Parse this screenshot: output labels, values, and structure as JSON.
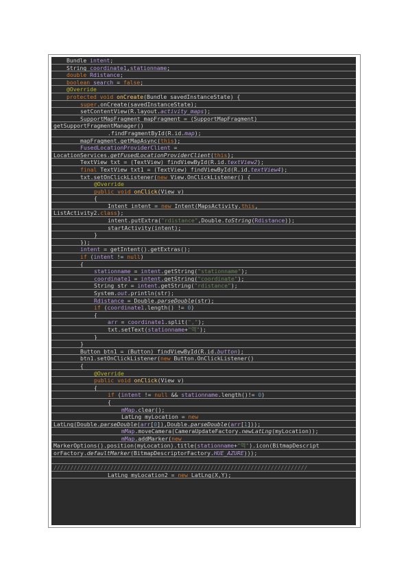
{
  "code": {
    "lines": [
      {
        "indent": 1,
        "segs": [
          {
            "t": "Bundle "
          },
          {
            "t": "intent",
            "c": "fld"
          },
          {
            "t": ";"
          }
        ]
      },
      {
        "indent": 1,
        "segs": [
          {
            "t": "String "
          },
          {
            "t": "coordinate1",
            "c": "fld"
          },
          {
            "t": ","
          },
          {
            "t": "stationname",
            "c": "fld"
          },
          {
            "t": ";"
          }
        ]
      },
      {
        "indent": 1,
        "segs": [
          {
            "t": "double ",
            "c": "kw"
          },
          {
            "t": "Rdistance",
            "c": "fld"
          },
          {
            "t": ";"
          }
        ]
      },
      {
        "indent": 1,
        "segs": [
          {
            "t": "boolean ",
            "c": "kw"
          },
          {
            "t": "search",
            "c": "fld"
          },
          {
            "t": " = "
          },
          {
            "t": "false",
            "c": "kw"
          },
          {
            "t": ";"
          }
        ]
      },
      {
        "indent": 1,
        "segs": [
          {
            "t": "@Override",
            "c": "ann"
          }
        ]
      },
      {
        "indent": 1,
        "segs": [
          {
            "t": "protected void ",
            "c": "kw"
          },
          {
            "t": "onCreate",
            "c": "mth"
          },
          {
            "t": "(Bundle savedInstanceState) {"
          }
        ]
      },
      {
        "indent": 2,
        "segs": [
          {
            "t": "super",
            "c": "kw"
          },
          {
            "t": ".onCreate(savedInstanceState);"
          }
        ]
      },
      {
        "indent": 2,
        "segs": [
          {
            "t": "setContentView(R.layout."
          },
          {
            "t": "activity_maps",
            "c": "fld ital"
          },
          {
            "t": ");"
          }
        ]
      },
      {
        "indent": 2,
        "segs": [
          {
            "t": "SupportMapFragment mapFragment = (SupportMapFragment)"
          }
        ]
      },
      {
        "indent": 0,
        "segs": [
          {
            "t": "getSupportFragmentManager()"
          }
        ]
      },
      {
        "indent": 4,
        "segs": [
          {
            "t": ".findFragmentById(R.id."
          },
          {
            "t": "map",
            "c": "fld ital"
          },
          {
            "t": ");"
          }
        ]
      },
      {
        "indent": 2,
        "segs": [
          {
            "t": "mapFragment.getMapAsync("
          },
          {
            "t": "this",
            "c": "kw"
          },
          {
            "t": ");"
          }
        ]
      },
      {
        "indent": 2,
        "segs": [
          {
            "t": "FusedLocationProviderClient",
            "c": "fld"
          },
          {
            "t": " ="
          }
        ]
      },
      {
        "indent": 0,
        "segs": [
          {
            "t": "LocationServices."
          },
          {
            "t": "getFusedLocationProviderClient",
            "c": "ital"
          },
          {
            "t": "("
          },
          {
            "t": "this",
            "c": "kw"
          },
          {
            "t": ");"
          }
        ]
      },
      {
        "indent": 2,
        "segs": [
          {
            "t": "TextView txt = (TextView) findViewById(R.id."
          },
          {
            "t": "textView2",
            "c": "fld ital"
          },
          {
            "t": ");"
          }
        ]
      },
      {
        "indent": 2,
        "segs": [
          {
            "t": "final ",
            "c": "kw"
          },
          {
            "t": "TextView txt1 = (TextView) findViewById(R.id."
          },
          {
            "t": "textView4",
            "c": "fld ital"
          },
          {
            "t": ");"
          }
        ]
      },
      {
        "indent": 2,
        "segs": [
          {
            "t": "txt.setOnClickListener("
          },
          {
            "t": "new ",
            "c": "kw"
          },
          {
            "t": "View.OnClickListener() {"
          }
        ]
      },
      {
        "indent": 3,
        "segs": [
          {
            "t": "@Override",
            "c": "ann"
          }
        ]
      },
      {
        "indent": 3,
        "segs": [
          {
            "t": "public void ",
            "c": "kw"
          },
          {
            "t": "onClick",
            "c": "mth"
          },
          {
            "t": "(View v)"
          }
        ]
      },
      {
        "indent": 3,
        "segs": [
          {
            "t": "{"
          }
        ]
      },
      {
        "indent": 4,
        "segs": [
          {
            "t": "Intent intent = "
          },
          {
            "t": "new ",
            "c": "kw"
          },
          {
            "t": "Intent(MapsActivity."
          },
          {
            "t": "this",
            "c": "kw"
          },
          {
            "t": ","
          }
        ]
      },
      {
        "indent": 0,
        "segs": [
          {
            "t": "ListActivity2."
          },
          {
            "t": "class",
            "c": "kw"
          },
          {
            "t": ");"
          }
        ]
      },
      {
        "indent": 4,
        "segs": [
          {
            "t": "intent.putExtra("
          },
          {
            "t": "\"rdistance\"",
            "c": "str"
          },
          {
            "t": ",Double."
          },
          {
            "t": "toString",
            "c": "ital"
          },
          {
            "t": "("
          },
          {
            "t": "Rdistance",
            "c": "fld"
          },
          {
            "t": "));"
          }
        ]
      },
      {
        "indent": 4,
        "segs": [
          {
            "t": "startActivity(intent);"
          }
        ]
      },
      {
        "indent": 3,
        "segs": [
          {
            "t": "}"
          }
        ]
      },
      {
        "indent": 2,
        "segs": [
          {
            "t": "});"
          }
        ]
      },
      {
        "indent": 2,
        "segs": [
          {
            "t": "intent",
            "c": "fld"
          },
          {
            "t": " = getIntent().getExtras();"
          }
        ]
      },
      {
        "indent": 2,
        "segs": [
          {
            "t": "if ",
            "c": "kw"
          },
          {
            "t": "("
          },
          {
            "t": "intent",
            "c": "fld"
          },
          {
            "t": " != "
          },
          {
            "t": "null",
            "c": "kw"
          },
          {
            "t": ")"
          }
        ]
      },
      {
        "indent": 2,
        "segs": [
          {
            "t": "{"
          }
        ]
      },
      {
        "indent": 3,
        "segs": [
          {
            "t": "stationname",
            "c": "fld"
          },
          {
            "t": " = "
          },
          {
            "t": "intent",
            "c": "fld"
          },
          {
            "t": ".getString("
          },
          {
            "t": "\"stationname\"",
            "c": "str"
          },
          {
            "t": ");"
          }
        ]
      },
      {
        "indent": 3,
        "segs": [
          {
            "t": "coordinate1",
            "c": "fld"
          },
          {
            "t": " = "
          },
          {
            "t": "intent",
            "c": "fld"
          },
          {
            "t": ".getString("
          },
          {
            "t": "\"coordinate\"",
            "c": "str"
          },
          {
            "t": ");"
          }
        ]
      },
      {
        "indent": 3,
        "segs": [
          {
            "t": "String str = "
          },
          {
            "t": "intent",
            "c": "fld"
          },
          {
            "t": ".getString("
          },
          {
            "t": "\"rdistance\"",
            "c": "str"
          },
          {
            "t": ");"
          }
        ]
      },
      {
        "indent": 3,
        "segs": [
          {
            "t": "System."
          },
          {
            "t": "out",
            "c": "fld ital"
          },
          {
            "t": ".println(str);"
          }
        ]
      },
      {
        "indent": 3,
        "segs": [
          {
            "t": "Rdistance",
            "c": "fld"
          },
          {
            "t": " = Double."
          },
          {
            "t": "parseDouble",
            "c": "ital"
          },
          {
            "t": "(str);"
          }
        ]
      },
      {
        "indent": 3,
        "segs": [
          {
            "t": "if ",
            "c": "kw"
          },
          {
            "t": "("
          },
          {
            "t": "coordinate1",
            "c": "fld"
          },
          {
            "t": ".length() != "
          },
          {
            "t": "0",
            "c": "num"
          },
          {
            "t": ")"
          }
        ]
      },
      {
        "indent": 3,
        "segs": [
          {
            "t": "{"
          }
        ]
      },
      {
        "indent": 4,
        "segs": [
          {
            "t": "arr",
            "c": "fld"
          },
          {
            "t": " = "
          },
          {
            "t": "coordinate1",
            "c": "fld"
          },
          {
            "t": ".split("
          },
          {
            "t": "\",\"",
            "c": "str"
          },
          {
            "t": ");"
          }
        ]
      },
      {
        "indent": 4,
        "segs": [
          {
            "t": "txt.setText("
          },
          {
            "t": "stationname",
            "c": "fld"
          },
          {
            "t": "+"
          },
          {
            "t": "\"역\"",
            "c": "str"
          },
          {
            "t": ");"
          }
        ]
      },
      {
        "indent": 3,
        "segs": [
          {
            "t": "}"
          }
        ]
      },
      {
        "indent": 2,
        "segs": [
          {
            "t": "}"
          }
        ]
      },
      {
        "indent": 2,
        "segs": [
          {
            "t": "Button btn1 = (Button) findViewById(R.id."
          },
          {
            "t": "button",
            "c": "fld ital"
          },
          {
            "t": ");"
          }
        ]
      },
      {
        "indent": 2,
        "segs": [
          {
            "t": "btn1.setOnClickListener("
          },
          {
            "t": "new ",
            "c": "kw"
          },
          {
            "t": "Button.OnClickListener()"
          }
        ]
      },
      {
        "indent": 2,
        "segs": [
          {
            "t": "{"
          }
        ]
      },
      {
        "indent": 3,
        "segs": [
          {
            "t": "@Override",
            "c": "ann"
          }
        ]
      },
      {
        "indent": 3,
        "segs": [
          {
            "t": "public void ",
            "c": "kw"
          },
          {
            "t": "onClick",
            "c": "mth"
          },
          {
            "t": "(View v)"
          }
        ]
      },
      {
        "indent": 3,
        "segs": [
          {
            "t": "{"
          }
        ]
      },
      {
        "indent": 4,
        "segs": [
          {
            "t": "if ",
            "c": "kw"
          },
          {
            "t": "("
          },
          {
            "t": "intent",
            "c": "fld"
          },
          {
            "t": " != "
          },
          {
            "t": "null ",
            "c": "kw"
          },
          {
            "t": "&& "
          },
          {
            "t": "stationname",
            "c": "fld"
          },
          {
            "t": ".length()!= "
          },
          {
            "t": "0",
            "c": "num"
          },
          {
            "t": ")"
          }
        ]
      },
      {
        "indent": 4,
        "segs": [
          {
            "t": "{"
          }
        ]
      },
      {
        "indent": 5,
        "segs": [
          {
            "t": "mMap",
            "c": "fld"
          },
          {
            "t": ".clear();"
          }
        ]
      },
      {
        "indent": 5,
        "segs": [
          {
            "t": "LatLng myLocation = "
          },
          {
            "t": "new",
            "c": "kw"
          }
        ]
      },
      {
        "indent": 0,
        "segs": [
          {
            "t": "LatLng(Double."
          },
          {
            "t": "parseDouble",
            "c": "ital"
          },
          {
            "t": "("
          },
          {
            "t": "arr",
            "c": "fld"
          },
          {
            "t": "["
          },
          {
            "t": "0",
            "c": "num"
          },
          {
            "t": "]),Double."
          },
          {
            "t": "parseDouble",
            "c": "ital"
          },
          {
            "t": "("
          },
          {
            "t": "arr",
            "c": "fld"
          },
          {
            "t": "["
          },
          {
            "t": "1",
            "c": "num"
          },
          {
            "t": "]));"
          }
        ]
      },
      {
        "indent": 5,
        "segs": [
          {
            "t": "mMap",
            "c": "fld"
          },
          {
            "t": ".moveCamera(CameraUpdateFactory."
          },
          {
            "t": "newLatLng",
            "c": "ital"
          },
          {
            "t": "(myLocation));"
          }
        ]
      },
      {
        "indent": 5,
        "segs": [
          {
            "t": "mMap",
            "c": "fld"
          },
          {
            "t": ".addMarker("
          },
          {
            "t": "new",
            "c": "kw"
          }
        ]
      },
      {
        "indent": 0,
        "segs": [
          {
            "t": "MarkerOptions().position(myLocation).title("
          },
          {
            "t": "stationname",
            "c": "fld"
          },
          {
            "t": "+"
          },
          {
            "t": "\"역\"",
            "c": "str"
          },
          {
            "t": ").icon(BitmapDescript"
          }
        ]
      },
      {
        "indent": 0,
        "segs": [
          {
            "t": "orFactory."
          },
          {
            "t": "defaultMarker",
            "c": "ital"
          },
          {
            "t": "(BitmapDescriptorFactory."
          },
          {
            "t": "HUE_AZURE",
            "c": "fld ital"
          },
          {
            "t": ")));"
          }
        ]
      },
      {
        "indent": 0,
        "segs": [
          {
            "t": ""
          }
        ]
      },
      {
        "indent": 0,
        "segs": [
          {
            "t": "////////////////////////////////////////////////////////////////////////////",
            "c": "cmt"
          }
        ]
      },
      {
        "indent": 4,
        "segs": [
          {
            "t": "LatLng myLocation2 = "
          },
          {
            "t": "new ",
            "c": "kw"
          },
          {
            "t": "LatLng(X,Y);"
          }
        ]
      }
    ]
  }
}
